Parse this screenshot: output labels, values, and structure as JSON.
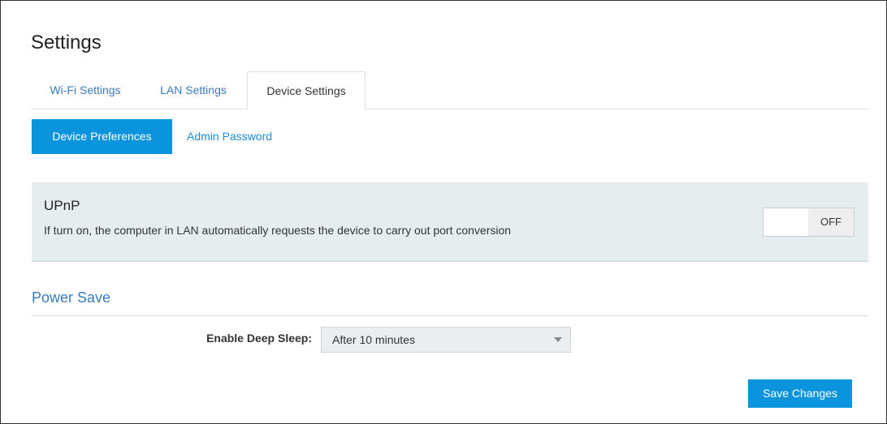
{
  "page": {
    "title": "Settings"
  },
  "tabs": [
    {
      "label": "Wi-Fi Settings",
      "active": false
    },
    {
      "label": "LAN Settings",
      "active": false
    },
    {
      "label": "Device Settings",
      "active": true
    }
  ],
  "subnav": {
    "active_label": "Device Preferences",
    "link_label": "Admin Password"
  },
  "upnp": {
    "title": "UPnP",
    "description": "If turn on, the computer in LAN automatically requests the device to carry out port conversion",
    "toggle_state": "OFF"
  },
  "power_save": {
    "title": "Power Save",
    "deep_sleep_label": "Enable Deep Sleep:",
    "deep_sleep_value": "After 10 minutes"
  },
  "actions": {
    "save_label": "Save Changes"
  },
  "colors": {
    "accent": "#0a94dd",
    "link": "#3a7bbf",
    "panel_bg": "#e6edef"
  },
  "icons": {
    "select_arrow": "chevron-down-icon"
  }
}
